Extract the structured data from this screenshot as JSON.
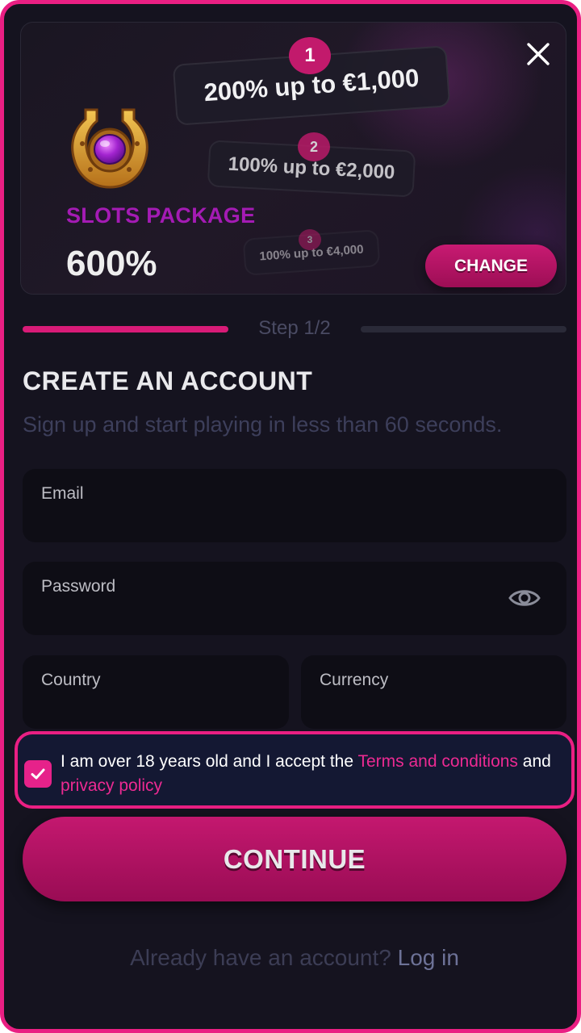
{
  "banner": {
    "tiers": [
      {
        "number": "1",
        "text": "200% up to €1,000"
      },
      {
        "number": "2",
        "text": "100% up to €2,000"
      },
      {
        "number": "3",
        "text": "100% up to €4,000"
      }
    ],
    "package_label": "SLOTS PACKAGE",
    "package_value": "600%",
    "change_label": "CHANGE"
  },
  "steps": {
    "label": "Step 1/2"
  },
  "form": {
    "title": "CREATE AN ACCOUNT",
    "subtitle": "Sign up and start playing in less than 60 seconds.",
    "email_label": "Email",
    "password_label": "Password",
    "country_label": "Country",
    "currency_label": "Currency",
    "terms_prefix": "I am over 18 years old and I accept the ",
    "terms_link": "Terms and conditions",
    "terms_middle": " and ",
    "privacy_link": "privacy policy",
    "continue_label": "CONTINUE"
  },
  "footer": {
    "question": "Already have an account?",
    "login_link": "Log in"
  },
  "colors": {
    "accent": "#ea1f83",
    "package_purple": "#a41bb4",
    "background": "#15131f"
  },
  "icons": {
    "close": "close-icon",
    "horseshoe": "horseshoe-gem-icon",
    "eye": "eye-icon",
    "check": "check-icon"
  },
  "checkbox_checked": true
}
